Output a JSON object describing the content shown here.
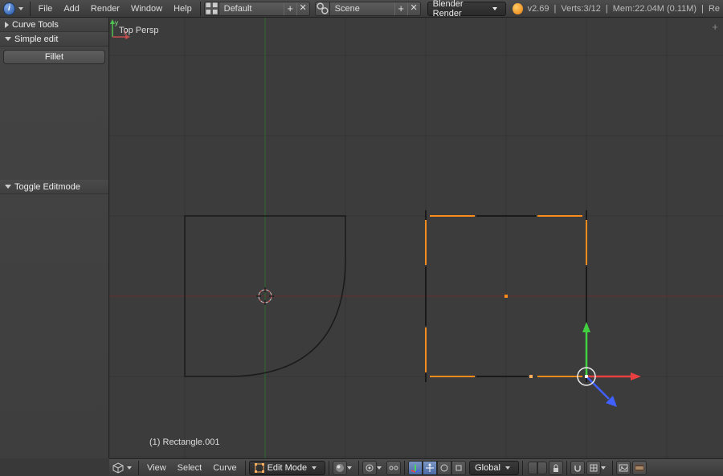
{
  "top_bar": {
    "menus": [
      "File",
      "Add",
      "Render",
      "Window",
      "Help"
    ],
    "layout_label": "Default",
    "scene_label": "Scene",
    "renderer_label": "Blender Render",
    "version": "v2.69",
    "stats": "Verts:3/12",
    "memory": "Mem:22.04M (0.11M)",
    "rest": "Re"
  },
  "left_panel": {
    "curve_tools_header": "Curve Tools",
    "simple_edit_header": "Simple edit",
    "fillet_btn": "Fillet",
    "toggle_editmode_header": "Toggle Editmode"
  },
  "viewport": {
    "top_label": "Top Persp",
    "object_label": "(1) Rectangle.001",
    "axis_y": "y",
    "axis_x": "x"
  },
  "view_header": {
    "menus": [
      "View",
      "Select",
      "Curve"
    ],
    "mode_label": "Edit Mode",
    "orientation_label": "Global"
  },
  "colors": {
    "grid": "#333333",
    "axis_x": "#8a3a3a",
    "axis_y": "#3a8a3a",
    "curve_black": "#1a1a1a",
    "selected": "#ff9933",
    "manip_x": "#e84040",
    "manip_y": "#40d040",
    "manip_z": "#4060ff"
  }
}
